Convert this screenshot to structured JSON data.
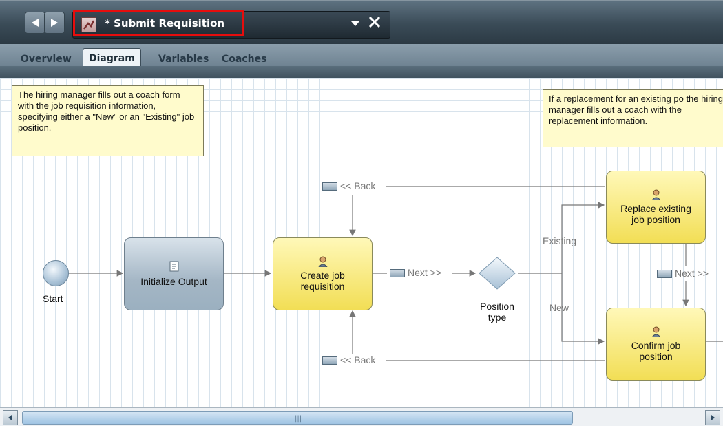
{
  "window": {
    "title": "* Submit Requisition"
  },
  "tabs": [
    {
      "label": "Overview"
    },
    {
      "label": "Diagram"
    },
    {
      "label": "Variables"
    },
    {
      "label": "Coaches"
    }
  ],
  "notes": {
    "left": "The hiring manager fills out a coach form with the job requisition information, specifying either a \"New\" or an \"Existing\" job position.",
    "right": "If a replacement for an existing po the hiring manager fills out a coach with the replacement information."
  },
  "diagram": {
    "start_label": "Start",
    "initialize_output": "Initialize Output",
    "create_job_requisition": "Create job requisition",
    "position_type": "Position type",
    "replace_existing": "Replace existing job position",
    "confirm_job_position": "Confirm job position",
    "flows": {
      "back_top": "<< Back",
      "back_bottom": "<< Back",
      "next_main": "Next >>",
      "next_right": "Next >>",
      "existing": "Existing",
      "new": "New"
    }
  },
  "colors": {
    "accent_red": "#e60d0d",
    "activity_yellow": "#f2de55",
    "activity_gray": "#a4b6c5"
  },
  "icons": [
    "back-arrow-icon",
    "forward-arrow-icon",
    "process-icon",
    "dropdown-icon",
    "close-icon",
    "person-icon",
    "script-icon",
    "message-icon",
    "scroll-left-icon",
    "scroll-right-icon"
  ]
}
